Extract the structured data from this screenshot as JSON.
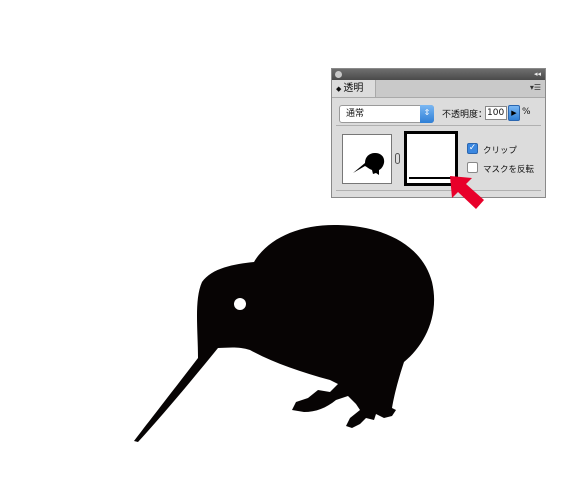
{
  "panel": {
    "tab_label": "透明",
    "blend_mode": "通常",
    "opacity_label": "不透明度：",
    "opacity_value": "100",
    "opacity_unit": "%",
    "clip_label": "クリップ",
    "invert_mask_label": "マスクを反転",
    "clip_checked": true,
    "invert_checked": false
  },
  "colors": {
    "accent": "#3a87e0",
    "arrow": "#e8002a",
    "artwork": "#070404"
  }
}
